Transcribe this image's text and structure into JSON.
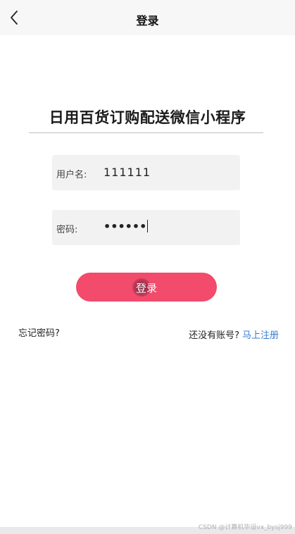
{
  "header": {
    "title": "登录",
    "back_icon": "chevron-left-icon"
  },
  "app": {
    "name": "日用百货订购配送微信小程序"
  },
  "form": {
    "username_label": "用户名:",
    "username_value": "111111",
    "password_label": "密码:",
    "password_value": "••••••",
    "submit_label": "登录"
  },
  "links": {
    "forgot": "忘记密码?",
    "no_account": "还没有账号?",
    "register": "马上注册"
  },
  "watermark": "CSDN @计算机毕设vx_bysj999",
  "colors": {
    "accent": "#f24b6b",
    "link": "#3a7bd5",
    "header_bg": "#f7f7f7",
    "field_bg": "#f2f2f2"
  }
}
